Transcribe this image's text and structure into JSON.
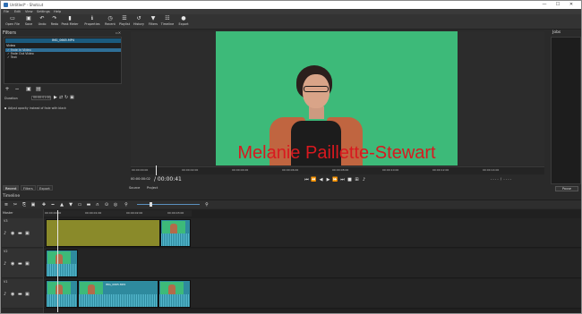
{
  "window": {
    "title": "Untitled* - Shotcut",
    "controls": [
      "—",
      "☐",
      "✕"
    ]
  },
  "menu": [
    "File",
    "Edit",
    "View",
    "Settings",
    "Help"
  ],
  "toolbar": [
    {
      "label": "Open File",
      "icon": "folder-open-icon",
      "glyph": "▭"
    },
    {
      "label": "Save",
      "icon": "save-icon",
      "glyph": "▣"
    },
    {
      "label": "Undo",
      "icon": "undo-icon",
      "glyph": "↶"
    },
    {
      "label": "Redo",
      "icon": "redo-icon",
      "glyph": "↷"
    },
    {
      "label": "Peak Meter",
      "icon": "peak-meter-icon",
      "glyph": "▮"
    },
    {
      "label": "Properties",
      "icon": "properties-icon",
      "glyph": "ℹ"
    },
    {
      "label": "Recent",
      "icon": "recent-icon",
      "glyph": "◷"
    },
    {
      "label": "Playlist",
      "icon": "playlist-icon",
      "glyph": "☰"
    },
    {
      "label": "History",
      "icon": "history-icon",
      "glyph": "↺"
    },
    {
      "label": "Filters",
      "icon": "filters-icon",
      "glyph": "▼"
    },
    {
      "label": "Timeline",
      "icon": "timeline-icon",
      "glyph": "☷"
    },
    {
      "label": "Export",
      "icon": "export-icon",
      "glyph": "●"
    }
  ],
  "filters": {
    "title": "Filters",
    "clip_name": "IMG_0665.MP4",
    "section": "Video",
    "items": [
      {
        "label": "✓ Fade In Video",
        "selected": true
      },
      {
        "label": "✓ Fade Out Video",
        "selected": false
      },
      {
        "label": "✓ Text",
        "selected": false
      }
    ],
    "duration_label": "Duration",
    "duration_value": "00:00:01:00",
    "hint": "Adjust opacity instead of fade with black",
    "tabs": [
      "Recent",
      "Filters",
      "Export"
    ]
  },
  "player": {
    "overlay_text": "Melanie Paillette-Stewart",
    "ruler_ticks": [
      "00:00:00:00",
      "00:00:02:00",
      "00:00:04:00",
      "00:00:06:00",
      "00:00:08:00",
      "00:00:10:00",
      "00:00:12:00",
      "00:00:14:00"
    ],
    "current_time": "00:00:00:02",
    "total_time": "/ 00:00:41",
    "source_tab": "Source",
    "project_tab": "Project",
    "transport_glyphs": [
      "⏮",
      "⏪",
      "◀",
      "▶",
      "⏩",
      "⏭",
      "■",
      "⊞",
      "♪"
    ]
  },
  "jobs": {
    "title": "Jobs",
    "pause_label": "Pause"
  },
  "timeline": {
    "title": "Timeline",
    "master_label": "Master",
    "ruler_ticks": [
      "00:00:00:00",
      "00:00:01:00",
      "00:00:02:00",
      "00:00:03:00"
    ],
    "tracks": [
      {
        "name": "V3"
      },
      {
        "name": "V2"
      },
      {
        "name": "V1"
      }
    ],
    "clip_label": "IMG_0665.MP4",
    "zoom_level": 0.2,
    "tools": [
      "≡",
      "✂",
      "⎘",
      "▣",
      "✚",
      "━",
      "▲",
      "▼",
      "▭",
      "▬",
      "∩",
      "⊙",
      "◎",
      "⚲",
      "⚲"
    ]
  },
  "colors": {
    "green_screen": "#3dba79",
    "overlay_text": "#d8191f",
    "selection": "#2e6e96",
    "olive_clip": "#8a8a2a",
    "teal_clip": "#2e8a9e"
  }
}
